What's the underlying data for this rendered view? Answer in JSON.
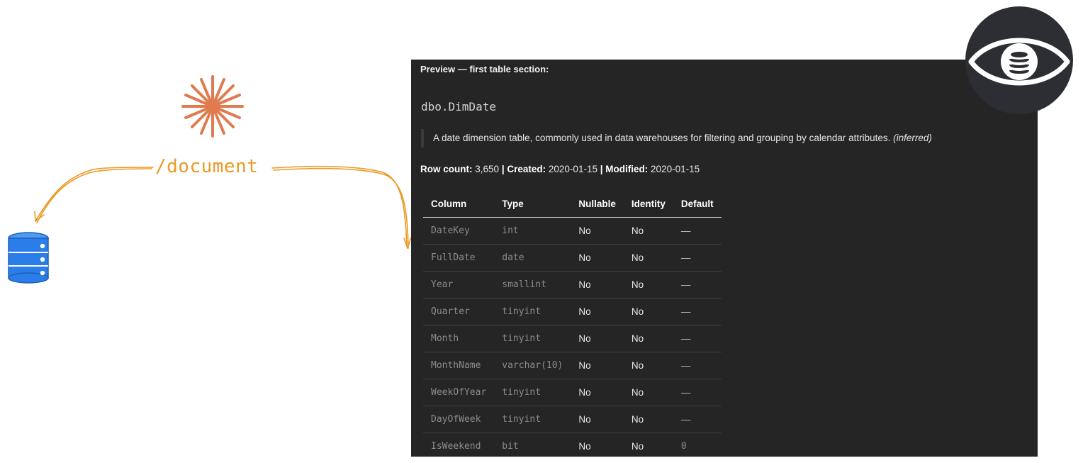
{
  "command": {
    "label": "/document"
  },
  "preview": {
    "heading": "Preview — first table section:",
    "table_name": "dbo.DimDate",
    "description": "A date dimension table, commonly used in data warehouses for filtering and grouping by calendar attributes.",
    "description_note": "(inferred)",
    "meta": {
      "row_count_label": "Row count:",
      "row_count": "3,650",
      "separator": "|",
      "created_label": "Created:",
      "created": "2020-01-15",
      "modified_label": "Modified:",
      "modified": "2020-01-15"
    },
    "columns_headers": [
      "Column",
      "Type",
      "Nullable",
      "Identity",
      "Default"
    ],
    "rows": [
      {
        "column": "DateKey",
        "type": "int",
        "nullable": "No",
        "identity": "No",
        "default": "—"
      },
      {
        "column": "FullDate",
        "type": "date",
        "nullable": "No",
        "identity": "No",
        "default": "—"
      },
      {
        "column": "Year",
        "type": "smallint",
        "nullable": "No",
        "identity": "No",
        "default": "—"
      },
      {
        "column": "Quarter",
        "type": "tinyint",
        "nullable": "No",
        "identity": "No",
        "default": "—"
      },
      {
        "column": "Month",
        "type": "tinyint",
        "nullable": "No",
        "identity": "No",
        "default": "—"
      },
      {
        "column": "MonthName",
        "type": "varchar(10)",
        "nullable": "No",
        "identity": "No",
        "default": "—"
      },
      {
        "column": "WeekOfYear",
        "type": "tinyint",
        "nullable": "No",
        "identity": "No",
        "default": "—"
      },
      {
        "column": "DayOfWeek",
        "type": "tinyint",
        "nullable": "No",
        "identity": "No",
        "default": "—"
      },
      {
        "column": "IsWeekend",
        "type": "bit",
        "nullable": "No",
        "identity": "No",
        "default": "0"
      }
    ]
  },
  "icons": {
    "spark": "sparkle-icon",
    "database": "database-icon",
    "logo": "eye-database-logo-icon"
  },
  "colors": {
    "accent_orange": "#ea9a24",
    "spark_orange": "#e07a4f",
    "database_blue": "#2b7de9",
    "panel_bg": "#252526",
    "logo_dark": "#2c2e33"
  }
}
